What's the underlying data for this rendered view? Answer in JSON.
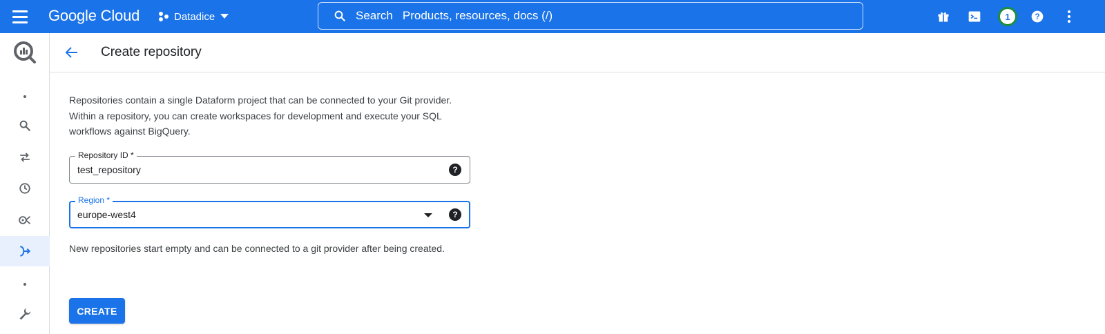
{
  "topbar": {
    "brand": "Google Cloud",
    "project_name": "Datadice",
    "search_label": "Search",
    "search_placeholder": "Products, resources, docs (/)",
    "notification_count": "1"
  },
  "rail": {
    "items": [
      {
        "icon": "bigquery-logo-icon"
      },
      {
        "icon": "dot-icon"
      },
      {
        "icon": "search-icon"
      },
      {
        "icon": "transfer-arrows-icon"
      },
      {
        "icon": "clock-icon"
      },
      {
        "icon": "analytics-hub-icon"
      },
      {
        "icon": "dataform-icon",
        "active": true
      },
      {
        "icon": "dot-icon"
      },
      {
        "icon": "wrench-icon"
      }
    ]
  },
  "header": {
    "title": "Create repository"
  },
  "form": {
    "intro": "Repositories contain a single Dataform project that can be connected to your Git provider. Within a repository, you can create workspaces for development and execute your SQL workflows against BigQuery.",
    "repository_id_label": "Repository ID *",
    "repository_id_value": "test_repository",
    "region_label": "Region *",
    "region_value": "europe-west4",
    "note": "New repositories start empty and can be connected to a git provider after being created.",
    "create_label": "CREATE"
  },
  "colors": {
    "brand_blue": "#1a73e8",
    "notification_ring": "#1e8e3e",
    "active_rail_bg": "#e8f0fe"
  }
}
